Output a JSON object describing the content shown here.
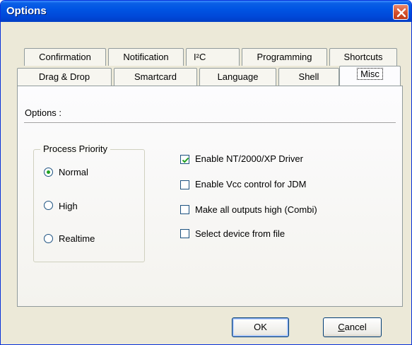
{
  "window": {
    "title": "Options"
  },
  "tabs": {
    "row1": [
      {
        "label": "Confirmation"
      },
      {
        "label": "Notification"
      },
      {
        "label": "I²C"
      },
      {
        "label": "Programming"
      },
      {
        "label": "Shortcuts"
      }
    ],
    "row2": [
      {
        "label": "Drag & Drop"
      },
      {
        "label": "Smartcard"
      },
      {
        "label": "Language"
      },
      {
        "label": "Shell"
      },
      {
        "label": "Misc",
        "selected": true
      }
    ]
  },
  "panel": {
    "section_label": "Options :",
    "process_priority": {
      "title": "Process Priority",
      "options": [
        {
          "label": "Normal",
          "selected": true
        },
        {
          "label": "High",
          "selected": false
        },
        {
          "label": "Realtime",
          "selected": false
        }
      ]
    },
    "checkboxes": [
      {
        "label": "Enable NT/2000/XP Driver",
        "checked": true
      },
      {
        "label": "Enable Vcc control for JDM",
        "checked": false
      },
      {
        "label": "Make all outputs high (Combi)",
        "checked": false
      },
      {
        "label": "Select device from file",
        "checked": false
      }
    ]
  },
  "buttons": {
    "ok": "OK",
    "cancel_first": "C",
    "cancel_rest": "ancel"
  },
  "colors": {
    "titlebar": "#0054e3",
    "close_button": "#d4502c",
    "radio_dot": "#21a121",
    "dialog_bg": "#ece9d8"
  }
}
